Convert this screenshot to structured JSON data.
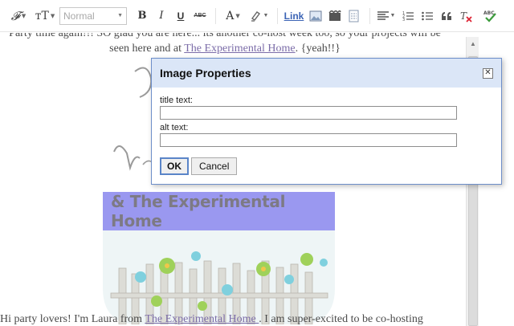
{
  "toolbar": {
    "font_glyph": "𝓕",
    "size_glyph": "тT",
    "format_value": "Normal",
    "bold": "B",
    "italic": "I",
    "underline": "U",
    "strike": "ABC",
    "text_color": "A",
    "link": "Link",
    "spellcheck": "ABC",
    "accent_color": "#3b63b5",
    "icons": [
      "font-family-icon",
      "font-size-icon",
      "bold-icon",
      "italic-icon",
      "underline-icon",
      "strikethrough-icon",
      "text-color-icon",
      "highlight-icon",
      "link-icon",
      "image-icon",
      "video-icon",
      "jump-break-icon",
      "align-icon",
      "numbered-list-icon",
      "bulleted-list-icon",
      "quote-icon",
      "remove-format-icon",
      "spellcheck-icon"
    ]
  },
  "editor": {
    "top_line1": "Party time again!!! SO glad you are here... its another co-host week too, so your projects will be",
    "top_line2_prefix": "seen here and at ",
    "top_link": "The Experimental Home",
    "top_line2_suffix": ". {yeah!!}",
    "banner_text": "& The Experimental Home",
    "bottom_prefix": "Hi party lovers! I'm Laura from  ",
    "bottom_link": "The Experimental Home ",
    "bottom_suffix": ". I am super-excited to be co-hosting"
  },
  "dialog": {
    "title": "Image Properties",
    "close_glyph": "✕",
    "title_label": "title text:",
    "title_value": "",
    "alt_label": "alt text:",
    "alt_value": "",
    "ok_label": "OK",
    "cancel_label": "Cancel"
  }
}
